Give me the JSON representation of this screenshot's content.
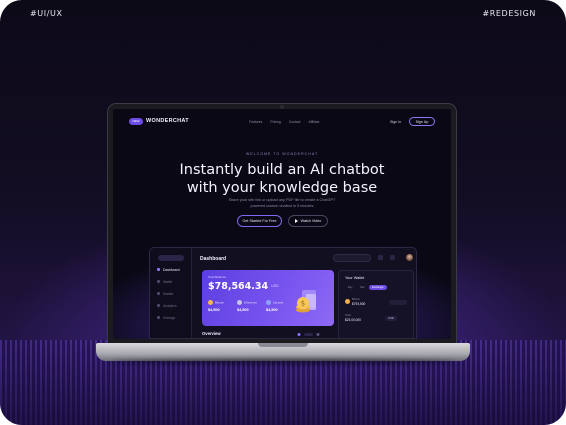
{
  "corner_tags": {
    "left": "#UI/UX",
    "right": "#REDESIGN"
  },
  "site": {
    "logo_badge": "NEW",
    "logo": "WONDERCHAT",
    "nav_links": [
      "Features",
      "Pricing",
      "Contact",
      "Affiliate"
    ],
    "sign_in": "Sign In",
    "sign_up": "Sign Up",
    "welcome": "WELCOME TO WONDERCHAT",
    "hero_line1": "Instantly build an AI chatbot",
    "hero_line2": "with your knowledge base",
    "subtitle": "Share your site link or upload any PDF file to create a ChatGPT powered custom chatbot in 5 minutes",
    "cta_primary": "Get Started For Free",
    "cta_secondary": "Watch Video"
  },
  "dashboard": {
    "title": "Dashboard",
    "sidebar": [
      {
        "label": "Dashboard",
        "active": true
      },
      {
        "label": "Wallet",
        "active": false
      },
      {
        "label": "Market",
        "active": false
      },
      {
        "label": "Analytics",
        "active": false
      },
      {
        "label": "Settings",
        "active": false
      }
    ],
    "balance_label": "Total Balance",
    "balance": "$78,564.34",
    "currency": "USD",
    "coins": [
      {
        "name": "Bitcoin",
        "value": "$4,500",
        "color": "#f5b64a"
      },
      {
        "name": "Ethereum",
        "value": "$4,500",
        "color": "#c8c4e8"
      },
      {
        "name": "Litecoin",
        "value": "$4,500",
        "color": "#8fa2ff"
      }
    ],
    "wallet": {
      "title": "Your Wallet",
      "tabs": [
        "Buy",
        "Sell",
        "Exchange"
      ],
      "active_tab": "Exchange",
      "rows": [
        {
          "label": "Bitcoin",
          "value": "$793,500",
          "pill": ""
        },
        {
          "label": "Total",
          "value": "$23,00,000",
          "pill": "USD"
        }
      ]
    },
    "overview": "Overview"
  },
  "colors": {
    "accent": "#6d4ce6",
    "background": "#0a0814",
    "floor": "#7850e6"
  }
}
